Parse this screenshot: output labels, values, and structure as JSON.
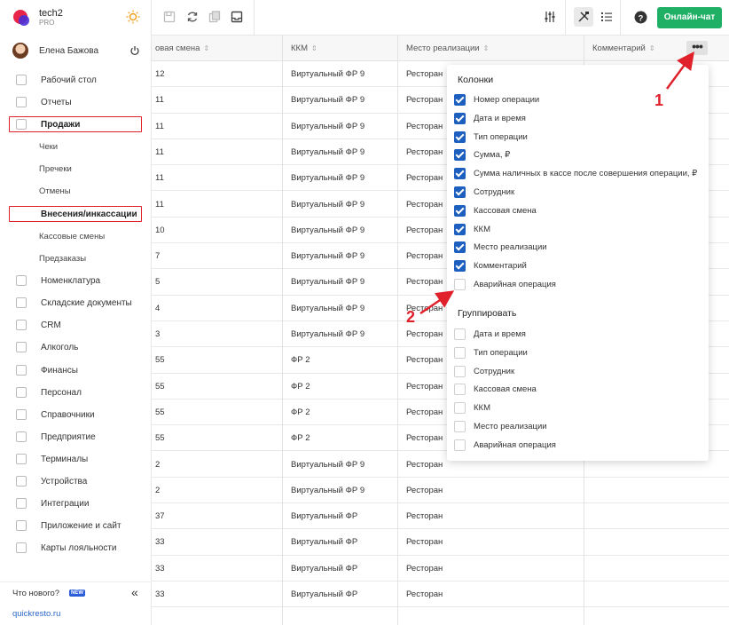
{
  "brand": {
    "name": "tech2",
    "sub": "PRO"
  },
  "user": {
    "name": "Елена Бажова"
  },
  "nav": [
    {
      "label": "Рабочий стол",
      "icon": "speedometer-icon",
      "sub": false,
      "highlight": false
    },
    {
      "label": "Отчеты",
      "icon": "chart-icon",
      "sub": false,
      "highlight": false
    },
    {
      "label": "Продажи",
      "icon": "basket-icon",
      "sub": false,
      "highlight": true
    },
    {
      "label": "Чеки",
      "sub": true,
      "highlight": false
    },
    {
      "label": "Пречеки",
      "sub": true,
      "highlight": false
    },
    {
      "label": "Отмены",
      "sub": true,
      "highlight": false
    },
    {
      "label": "Внесения/инкассации",
      "sub": true,
      "highlight": true
    },
    {
      "label": "Кассовые смены",
      "sub": true,
      "highlight": false
    },
    {
      "label": "Предзаказы",
      "sub": true,
      "highlight": false
    },
    {
      "label": "Номенклатура",
      "icon": "tag-icon",
      "sub": false,
      "highlight": false
    },
    {
      "label": "Складские документы",
      "icon": "box-icon",
      "sub": false,
      "highlight": false
    },
    {
      "label": "CRM",
      "icon": "people-icon",
      "sub": false,
      "highlight": false
    },
    {
      "label": "Алкоголь",
      "icon": "glass-icon",
      "sub": false,
      "highlight": false
    },
    {
      "label": "Финансы",
      "icon": "wallet-icon",
      "sub": false,
      "highlight": false
    },
    {
      "label": "Персонал",
      "icon": "person-icon",
      "sub": false,
      "highlight": false
    },
    {
      "label": "Справочники",
      "icon": "book-icon",
      "sub": false,
      "highlight": false
    },
    {
      "label": "Предприятие",
      "icon": "building-icon",
      "sub": false,
      "highlight": false
    },
    {
      "label": "Терминалы",
      "icon": "terminal-icon",
      "sub": false,
      "highlight": false
    },
    {
      "label": "Устройства",
      "icon": "printer-icon",
      "sub": false,
      "highlight": false
    },
    {
      "label": "Интеграции",
      "icon": "link-icon",
      "sub": false,
      "highlight": false
    },
    {
      "label": "Приложение и сайт",
      "icon": "monitor-icon",
      "sub": false,
      "highlight": false
    },
    {
      "label": "Карты лояльности",
      "icon": "card-icon",
      "sub": false,
      "highlight": false
    }
  ],
  "footer": {
    "whats_new": "Что нового?",
    "new_badge": "NEW",
    "collapse": "«",
    "site": "quickresto.ru"
  },
  "toolbar": {
    "chat": "Онлайн-чат",
    "more": "•••"
  },
  "table": {
    "headers": [
      "овая смена",
      "ККМ",
      "Место реализации",
      "Комментарий"
    ],
    "rows": [
      [
        "12",
        "Виртуальный ФР 9",
        "Ресторан"
      ],
      [
        "11",
        "Виртуальный ФР 9",
        "Ресторан"
      ],
      [
        "11",
        "Виртуальный ФР 9",
        "Ресторан"
      ],
      [
        "11",
        "Виртуальный ФР 9",
        "Ресторан"
      ],
      [
        "11",
        "Виртуальный ФР 9",
        "Ресторан"
      ],
      [
        "11",
        "Виртуальный ФР 9",
        "Ресторан"
      ],
      [
        "10",
        "Виртуальный ФР 9",
        "Ресторан"
      ],
      [
        "7",
        "Виртуальный ФР 9",
        "Ресторан"
      ],
      [
        "5",
        "Виртуальный ФР 9",
        "Ресторан"
      ],
      [
        "4",
        "Виртуальный ФР 9",
        "Ресторан"
      ],
      [
        "3",
        "Виртуальный ФР 9",
        "Ресторан"
      ],
      [
        "55",
        "ФР 2",
        "Ресторан"
      ],
      [
        "55",
        "ФР 2",
        "Ресторан"
      ],
      [
        "55",
        "ФР 2",
        "Ресторан"
      ],
      [
        "55",
        "ФР 2",
        "Ресторан"
      ],
      [
        "2",
        "Виртуальный ФР 9",
        "Ресторан"
      ],
      [
        "2",
        "Виртуальный ФР 9",
        "Ресторан"
      ],
      [
        "37",
        "Виртуальный ФР",
        "Ресторан"
      ],
      [
        "33",
        "Виртуальный ФР",
        "Ресторан"
      ],
      [
        "33",
        "Виртуальный ФР",
        "Ресторан"
      ],
      [
        "33",
        "Виртуальный ФР",
        "Ресторан"
      ]
    ]
  },
  "dropdown": {
    "columns_title": "Колонки",
    "columns": [
      {
        "label": "Номер операции",
        "checked": true
      },
      {
        "label": "Дата и время",
        "checked": true
      },
      {
        "label": "Тип операции",
        "checked": true
      },
      {
        "label": "Сумма, ₽",
        "checked": true
      },
      {
        "label": "Сумма наличных в кассе после совершения операции, ₽",
        "checked": true
      },
      {
        "label": "Сотрудник",
        "checked": true
      },
      {
        "label": "Кассовая смена",
        "checked": true
      },
      {
        "label": "ККМ",
        "checked": true
      },
      {
        "label": "Место реализации",
        "checked": true
      },
      {
        "label": "Комментарий",
        "checked": true
      },
      {
        "label": "Аварийная операция",
        "checked": false
      }
    ],
    "group_title": "Группировать",
    "group": [
      {
        "label": "Дата и время",
        "checked": false
      },
      {
        "label": "Тип операции",
        "checked": false
      },
      {
        "label": "Сотрудник",
        "checked": false
      },
      {
        "label": "Кассовая смена",
        "checked": false
      },
      {
        "label": "ККМ",
        "checked": false
      },
      {
        "label": "Место реализации",
        "checked": false
      },
      {
        "label": "Аварийная операция",
        "checked": false
      }
    ]
  },
  "annotations": {
    "one": "1",
    "two": "2"
  },
  "colors": {
    "accent_red": "#e0202a",
    "chat_green": "#1fb066",
    "checkbox_blue": "#1d5fbf"
  }
}
